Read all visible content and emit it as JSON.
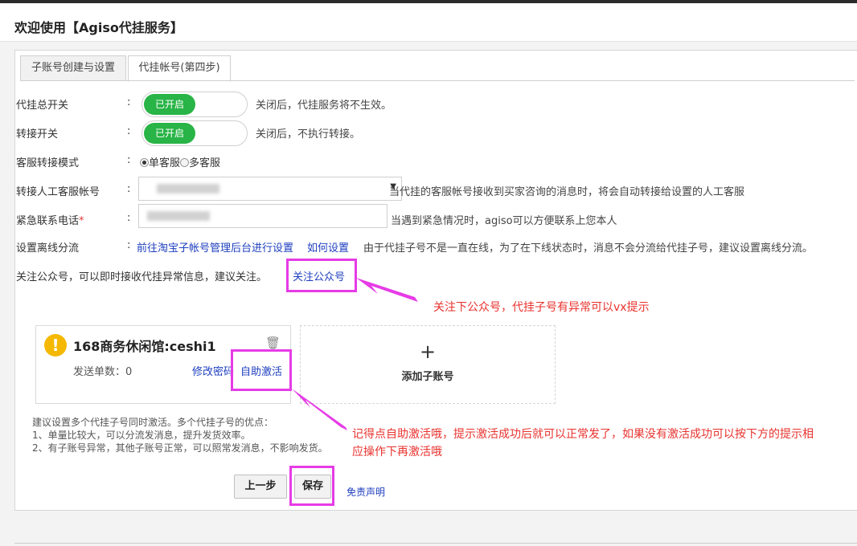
{
  "header": {
    "title": "欢迎使用【Agiso代挂服务】"
  },
  "tabs": [
    {
      "label": "子账号创建与设置",
      "active": false
    },
    {
      "label": "代挂帐号(第四步)",
      "active": true
    }
  ],
  "form": {
    "master_switch": {
      "label": "代挂总开关",
      "colon": ":",
      "state": "已开启",
      "desc": "关闭后，代挂服务将不生效。"
    },
    "transfer_switch": {
      "label": "转接开关",
      "colon": ":",
      "state": "已开启",
      "desc": "关闭后，不执行转接。"
    },
    "transfer_mode": {
      "label": "客服转接模式",
      "colon": ":",
      "options": [
        "单客服",
        "多客服"
      ],
      "selected": "单客服"
    },
    "agent_account": {
      "label": "转接人工客服帐号",
      "colon": ":",
      "desc": "当代挂的客服帐号接收到买家咨询的消息时，将会自动转接给设置的人工客服"
    },
    "emergency_phone": {
      "label": "紧急联系电话",
      "required_mark": "*",
      "colon": ":",
      "desc": "当遇到紧急情况时，agiso可以方便联系上您本人"
    },
    "offline_routing": {
      "label": "设置离线分流",
      "colon": ":",
      "link1": "前往淘宝子帐号管理后台进行设置",
      "link2": "如何设置",
      "desc": "由于代挂子号不是一直在线，为了在下线状态时，消息不会分流给代挂子号，建议设置离线分流。"
    },
    "follow": {
      "text": "关注公众号，可以即时接收代挂异常信息，建议关注。",
      "link": "关注公众号"
    }
  },
  "annotations": {
    "follow_note": "关注下公众号，代挂子号有异常可以vx提示",
    "activate_note_line1": "记得点自助激活哦，提示激活成功后就可以正常发了，如果没有激活成功可以按下方的提示相",
    "activate_note_line2": "应操作下再激活哦",
    "color": "#e8322e",
    "highlight_color": "#e63be6"
  },
  "account_card": {
    "icon": "warning-icon",
    "name": "168商务休闲馆:ceshi1",
    "sent_label": "发送单数：0",
    "change_password": "修改密码",
    "self_activate": "自助激活"
  },
  "add_card": {
    "plus": "+",
    "label": "添加子账号"
  },
  "tips": {
    "line1": "建议设置多个代挂子号同时激活。多个代挂子号的优点：",
    "line2": "1、单量比较大，可以分流发消息，提升发货效率。",
    "line3": "2、有子账号异常，其他子账号正常，可以照常发消息，不影响发货。"
  },
  "actions": {
    "prev": "上一步",
    "save": "保存",
    "disclaimer": "免责声明"
  },
  "colors": {
    "toggle_on": "#28b446",
    "link": "#1e3fbf",
    "warning": "#f5b800"
  }
}
